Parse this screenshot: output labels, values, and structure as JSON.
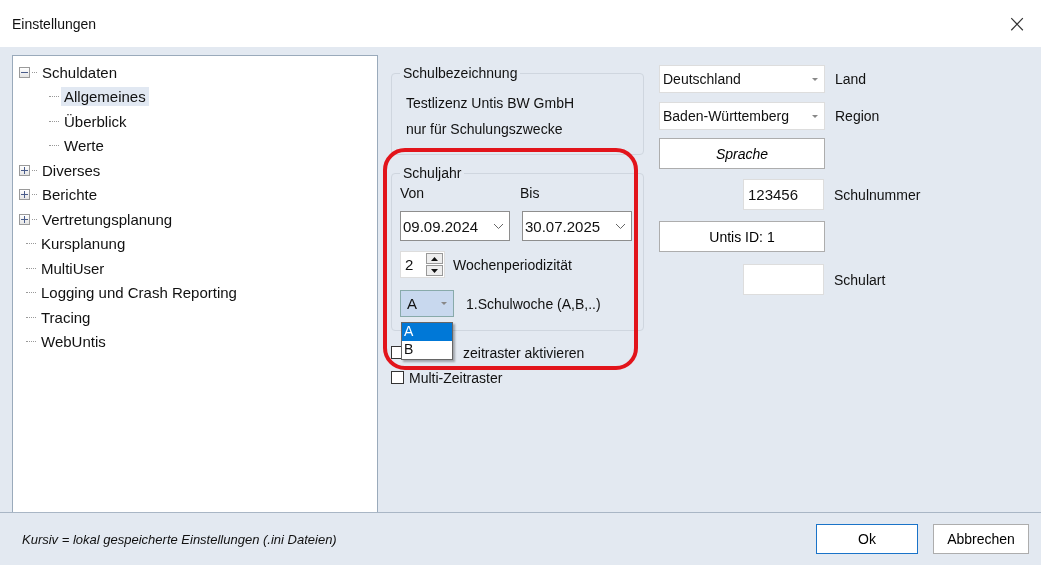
{
  "window": {
    "title": "Einstellungen",
    "close": "×"
  },
  "tree": [
    {
      "label": "Schuldaten",
      "expanded": true,
      "selected": false,
      "children": [
        {
          "label": "Allgemeines",
          "selected": true
        },
        {
          "label": "Überblick",
          "selected": false
        },
        {
          "label": "Werte",
          "selected": false
        }
      ]
    },
    {
      "label": "Diverses",
      "expanded": false,
      "selected": false
    },
    {
      "label": "Berichte",
      "expanded": false,
      "selected": false
    },
    {
      "label": "Vertretungsplanung",
      "expanded": false,
      "selected": false
    },
    {
      "label": "Kursplanung",
      "selected": false
    },
    {
      "label": "MultiUser",
      "selected": false
    },
    {
      "label": "Logging und Crash Reporting",
      "selected": false
    },
    {
      "label": "Tracing",
      "selected": false
    },
    {
      "label": "WebUntis",
      "selected": false
    }
  ],
  "schulbezeichnung": {
    "title": "Schulbezeichnung",
    "lines": [
      "Testlizenz Untis BW GmbH",
      "nur für Schulungszwecke"
    ]
  },
  "schuljahr": {
    "title": "Schuljahr",
    "from_label": "Von",
    "to_label": "Bis",
    "from": "09.09.2024",
    "to": "30.07.2025",
    "periodicity": "2",
    "periodicity_label": "Wochenperiodizität",
    "first_week": "A",
    "first_week_label": "1.Schulwoche (A,B,..)",
    "first_week_options": [
      {
        "label": "A",
        "selected": true
      },
      {
        "label": "B",
        "selected": false
      }
    ]
  },
  "checkboxes": [
    {
      "label": "zeitraster aktivieren",
      "checked": false
    },
    {
      "label": "Multi-Zeitraster",
      "checked": false
    }
  ],
  "land": {
    "value": "Deutschland",
    "label": "Land"
  },
  "region": {
    "value": "Baden-Württemberg",
    "label": "Region"
  },
  "sprache_button": "Sprache",
  "schulnummer": {
    "value": "123456",
    "label": "Schulnummer"
  },
  "untis_id_button": "Untis ID: 1",
  "schulart": {
    "label": "Schulart"
  },
  "footer": {
    "note": "Kursiv = lokal gespeicherte Einstellungen (.ini Dateien)",
    "buttons": [
      "Ok",
      "Abbrechen"
    ]
  }
}
